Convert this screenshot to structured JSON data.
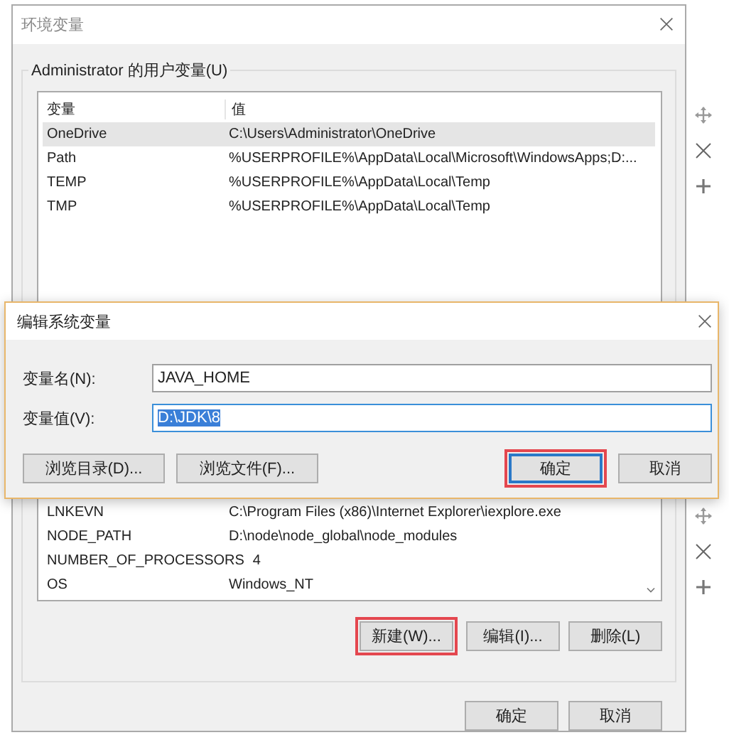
{
  "window": {
    "title": "环境变量"
  },
  "user_variables": {
    "label": "Administrator 的用户变量(U)",
    "columns": [
      "变量",
      "值"
    ],
    "rows": [
      {
        "name": "OneDrive",
        "value": "C:\\Users\\Administrator\\OneDrive",
        "selected": true
      },
      {
        "name": "Path",
        "value": "%USERPROFILE%\\AppData\\Local\\Microsoft\\WindowsApps;D:...",
        "selected": false
      },
      {
        "name": "TEMP",
        "value": "%USERPROFILE%\\AppData\\Local\\Temp",
        "selected": false
      },
      {
        "name": "TMP",
        "value": "%USERPROFILE%\\AppData\\Local\\Temp",
        "selected": false
      }
    ]
  },
  "system_variables": {
    "rows": [
      {
        "name": "LNKEVN",
        "value": "C:\\Program Files (x86)\\Internet Explorer\\iexplore.exe",
        "selected": false
      },
      {
        "name": "NODE_PATH",
        "value": "D:\\node\\node_global\\node_modules",
        "selected": false
      },
      {
        "name": "NUMBER_OF_PROCESSORS",
        "value": "4",
        "selected": false
      },
      {
        "name": "OS",
        "value": "Windows_NT",
        "selected": false
      }
    ],
    "buttons": [
      {
        "label": "新建(W)...",
        "highlighted": true
      },
      {
        "label": "编辑(I)...",
        "highlighted": false
      },
      {
        "label": "删除(L)",
        "highlighted": false
      }
    ]
  },
  "footer_buttons": [
    {
      "label": "确定"
    },
    {
      "label": "取消"
    }
  ],
  "edit_dialog": {
    "title": "编辑系统变量",
    "fields": [
      {
        "label": "变量名(N):",
        "value": "JAVA_HOME",
        "focused": false,
        "text_selected": false
      },
      {
        "label": "变量值(V):",
        "value": "D:\\JDK\\8",
        "focused": true,
        "text_selected": true
      }
    ],
    "buttons": [
      {
        "label": "浏览目录(D)...",
        "highlighted": false,
        "default": false
      },
      {
        "label": "浏览文件(F)...",
        "highlighted": false,
        "default": false
      },
      {
        "label": "确定",
        "highlighted": true,
        "default": true
      },
      {
        "label": "取消",
        "highlighted": false,
        "default": false
      }
    ]
  }
}
